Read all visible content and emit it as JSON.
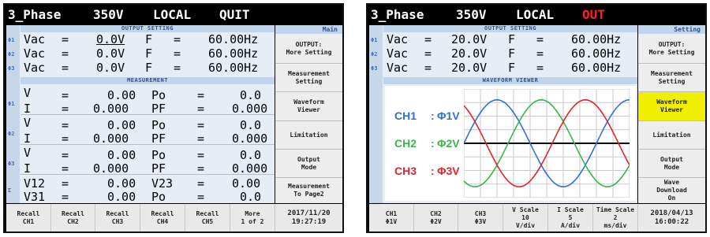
{
  "left": {
    "topbar": {
      "model": "3_Phase",
      "voltage": "350V",
      "mode": "LOCAL",
      "status": "QUIT"
    },
    "output_setting": {
      "title": "OUTPUT SETTING",
      "rows": [
        {
          "phase": "Φ1",
          "label": "Vac",
          "eq": "=",
          "value": "0.0V",
          "flabel": "F",
          "feq": "=",
          "freq": "60.00Hz"
        },
        {
          "phase": "Φ2",
          "label": "Vac",
          "eq": "=",
          "value": "0.0V",
          "flabel": "F",
          "feq": "=",
          "freq": "60.00Hz"
        },
        {
          "phase": "Φ3",
          "label": "Vac",
          "eq": "=",
          "value": "0.0V",
          "flabel": "F",
          "feq": "=",
          "freq": "60.00Hz"
        }
      ]
    },
    "measurement": {
      "title": "MEASUREMENT",
      "groups": [
        {
          "phase": "Φ1",
          "rows": [
            {
              "a": "V",
              "av": "0.00",
              "b": "Po",
              "bv": "0.0"
            },
            {
              "a": "I",
              "av": "0.000",
              "b": "PF",
              "bv": "0.000"
            }
          ]
        },
        {
          "phase": "Φ2",
          "rows": [
            {
              "a": "V",
              "av": "0.00",
              "b": "Po",
              "bv": "0.0"
            },
            {
              "a": "I",
              "av": "0.000",
              "b": "PF",
              "bv": "0.000"
            }
          ]
        },
        {
          "phase": "Φ3",
          "rows": [
            {
              "a": "V",
              "av": "0.00",
              "b": "Po",
              "bv": "0.0"
            },
            {
              "a": "I",
              "av": "0.000",
              "b": "PF",
              "bv": "0.000"
            }
          ]
        },
        {
          "phase": "Σ",
          "rows": [
            {
              "a": "V12",
              "av": "0.00",
              "b": "V23",
              "bv": "0.00"
            },
            {
              "a": "V31",
              "av": "0.00",
              "b": "Po",
              "bv": "0.0"
            }
          ]
        }
      ],
      "eq": "="
    },
    "side": {
      "header": "Main",
      "buttons": [
        "OUTPUT:\nMore Setting",
        "Measurement\nSetting",
        "Waveform\nViewer",
        "Limitation",
        "Output\nMode",
        "Measurement\nTo Page2"
      ]
    },
    "bottom": {
      "buttons": [
        "Recall\nCH1",
        "Recall\nCH2",
        "Recall\nCH3",
        "Recall\nCH4",
        "Recall\nCH5",
        "More\n1 of 2"
      ],
      "datetime": "2017/11/20\n19:27:19"
    }
  },
  "right": {
    "topbar": {
      "model": "3_Phase",
      "voltage": "350V",
      "mode": "LOCAL",
      "status": "OUT"
    },
    "output_setting": {
      "title": "OUTPUT SETTING",
      "rows": [
        {
          "phase": "Φ1",
          "label": "Vac",
          "eq": "=",
          "value": "20.0V",
          "flabel": "F",
          "feq": "=",
          "freq": "60.00Hz"
        },
        {
          "phase": "Φ2",
          "label": "Vac",
          "eq": "=",
          "value": "20.0V",
          "flabel": "F",
          "feq": "=",
          "freq": "60.00Hz"
        },
        {
          "phase": "Φ3",
          "label": "Vac",
          "eq": "=",
          "value": "20.0V",
          "flabel": "F",
          "feq": "=",
          "freq": "60.00Hz"
        }
      ]
    },
    "waveform_viewer": {
      "title": "WAVEFORM VIEWER",
      "channels": [
        {
          "name": "CH1",
          "sep": ":",
          "label": "Φ1V",
          "color": "#2f6fd6"
        },
        {
          "name": "CH2",
          "sep": ":",
          "label": "Φ2V",
          "color": "#39b54a"
        },
        {
          "name": "CH3",
          "sep": ":",
          "label": "Φ3V",
          "color": "#e0242b"
        }
      ]
    },
    "side": {
      "header": "Setting",
      "buttons": [
        "OUTPUT:\nMore Setting",
        "Measurement\nSetting",
        "Waveform\nViewer",
        "Limitation",
        "Output\nMode",
        "Wave\nDownload\nOn"
      ],
      "active_index": 2
    },
    "bottom": {
      "buttons": [
        "CH1\nΦ1V",
        "CH2\nΦ2V",
        "CH3\nΦ3V",
        "V Scale\n10\nV/div",
        "I Scale\n5\nA/div",
        "Time Scale\n2\nms/div"
      ],
      "datetime": "2018/04/13\n16:00:22"
    }
  },
  "colors": {
    "header_band": "#c2d4ec",
    "header_text": "#2f4f8f",
    "active_button": "#f0ef00",
    "out_status": "#ff2020"
  }
}
